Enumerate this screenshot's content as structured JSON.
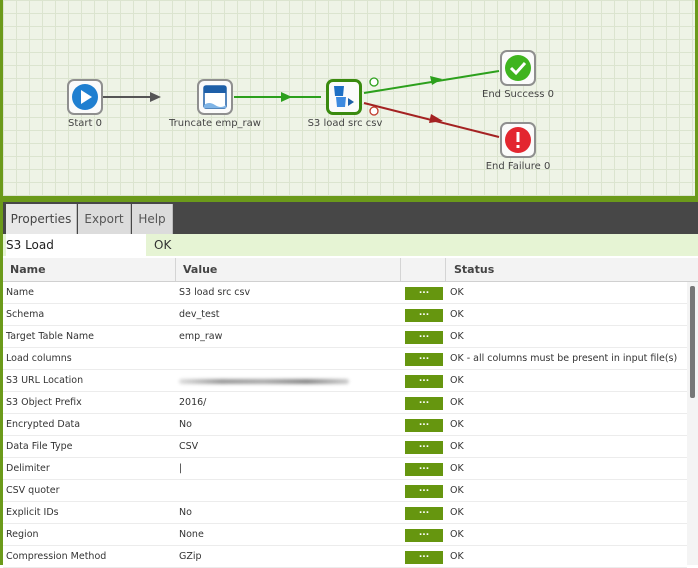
{
  "workflow": {
    "nodes": {
      "start": "Start 0",
      "truncate": "Truncate emp_raw",
      "s3load": "S3 load src csv",
      "end_success": "End Success 0",
      "end_failure": "End Failure 0"
    }
  },
  "panel": {
    "tabs": [
      "Properties",
      "Export",
      "Help"
    ],
    "component_name": "S3 Load",
    "component_status": "OK",
    "columns": {
      "name": "Name",
      "value": "Value",
      "status": "Status"
    },
    "edit_button_label": "...",
    "rows": [
      {
        "name": "Name",
        "value": "S3 load src csv",
        "status": "OK"
      },
      {
        "name": "Schema",
        "value": "dev_test",
        "status": "OK"
      },
      {
        "name": "Target Table Name",
        "value": "emp_raw",
        "status": "OK"
      },
      {
        "name": "Load columns",
        "value": "",
        "status": "OK - all columns must be present in input file(s)"
      },
      {
        "name": "S3 URL Location",
        "value": "",
        "status": "OK"
      },
      {
        "name": "S3 Object Prefix",
        "value": "2016/",
        "status": "OK"
      },
      {
        "name": "Encrypted Data",
        "value": "No",
        "status": "OK"
      },
      {
        "name": "Data File Type",
        "value": "CSV",
        "status": "OK"
      },
      {
        "name": "Delimiter",
        "value": "|",
        "status": "OK"
      },
      {
        "name": "CSV quoter",
        "value": "",
        "status": "OK"
      },
      {
        "name": "Explicit IDs",
        "value": "No",
        "status": "OK"
      },
      {
        "name": "Region",
        "value": "None",
        "status": "OK"
      },
      {
        "name": "Compression Method",
        "value": "GZip",
        "status": "OK"
      }
    ]
  },
  "colors": {
    "accent": "#6b9a1a",
    "success": "#3fb41f",
    "failure": "#e3262f",
    "button": "#66960f"
  }
}
